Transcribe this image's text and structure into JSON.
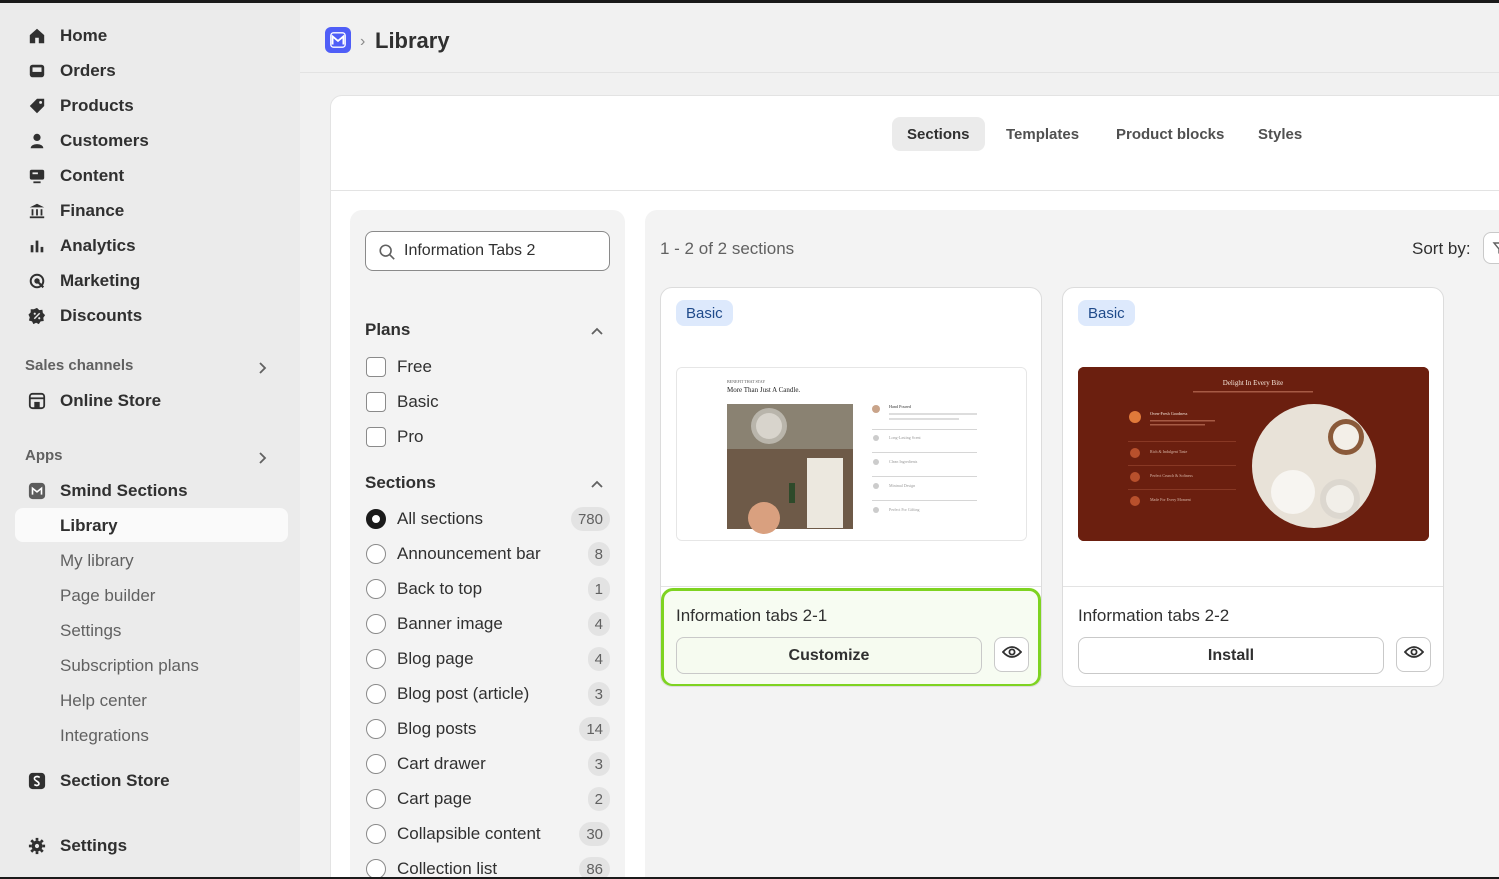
{
  "sidebar": {
    "main_items": [
      {
        "label": "Home",
        "icon": "home-icon"
      },
      {
        "label": "Orders",
        "icon": "inbox-icon"
      },
      {
        "label": "Products",
        "icon": "tag-icon"
      },
      {
        "label": "Customers",
        "icon": "person-icon"
      },
      {
        "label": "Content",
        "icon": "monitor-icon"
      },
      {
        "label": "Finance",
        "icon": "bank-icon"
      },
      {
        "label": "Analytics",
        "icon": "bar-chart-icon"
      },
      {
        "label": "Marketing",
        "icon": "target-icon"
      },
      {
        "label": "Discounts",
        "icon": "discount-icon"
      }
    ],
    "sales_channels_label": "Sales channels",
    "online_store_label": "Online Store",
    "apps_label": "Apps",
    "app_name": "Smind Sections",
    "app_sub_items": [
      "Library",
      "My library",
      "Page builder",
      "Settings",
      "Subscription plans",
      "Help center",
      "Integrations"
    ],
    "section_store_label": "Section Store",
    "settings_label": "Settings"
  },
  "header": {
    "breadcrumb_separator": "›",
    "title": "Library"
  },
  "tabs": [
    "Sections",
    "Templates",
    "Product blocks",
    "Styles"
  ],
  "active_tab": "Sections",
  "filters": {
    "search_value": "Information Tabs 2",
    "plans_title": "Plans",
    "plans": [
      "Free",
      "Basic",
      "Pro"
    ],
    "sections_title": "Sections",
    "sections": [
      {
        "label": "All sections",
        "count": "780",
        "selected": true
      },
      {
        "label": "Announcement bar",
        "count": "8"
      },
      {
        "label": "Back to top",
        "count": "1"
      },
      {
        "label": "Banner image",
        "count": "4"
      },
      {
        "label": "Blog page",
        "count": "4"
      },
      {
        "label": "Blog post (article)",
        "count": "3"
      },
      {
        "label": "Blog posts",
        "count": "14"
      },
      {
        "label": "Cart drawer",
        "count": "3"
      },
      {
        "label": "Cart page",
        "count": "2"
      },
      {
        "label": "Collapsible content",
        "count": "30"
      },
      {
        "label": "Collection list",
        "count": "86"
      }
    ]
  },
  "results": {
    "count_text": "1 - 2 of 2 sections",
    "sort_label": "Sort by:",
    "cards": [
      {
        "badge": "Basic",
        "name": "Information tabs 2-1",
        "button": "Customize",
        "preview": {
          "eyebrow": "BENEFIT THAT STAY",
          "heading": "More Than Just A Candle.",
          "tabs": [
            "Hand Poured",
            "Long-Lasting Scent",
            "Clean Ingredients",
            "Minimal Design",
            "Perfect For Gifting"
          ]
        }
      },
      {
        "badge": "Basic",
        "name": "Information tabs 2-2",
        "button": "Install",
        "preview": {
          "heading": "Delight In Every Bite",
          "tabs": [
            "Oven-Fresh Goodness",
            "Rich & Indulgent Taste",
            "Perfect Crunch & Softness",
            "Made For Every Moment"
          ]
        }
      }
    ]
  },
  "colors": {
    "accent_app": "#4f5ef7",
    "highlight": "#7ed321",
    "badge_bg": "#dde9fc",
    "card2_bg": "#6b1f0f"
  }
}
